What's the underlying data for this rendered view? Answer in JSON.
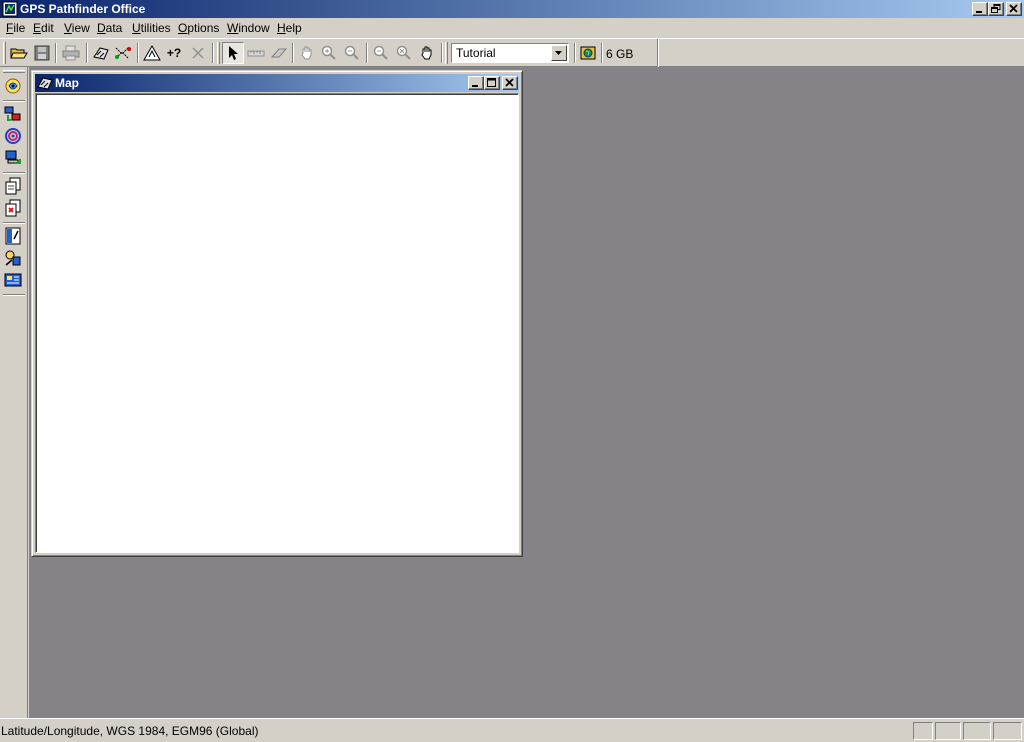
{
  "app": {
    "title": "GPS Pathfinder Office",
    "window_controls": [
      "minimize",
      "restore",
      "close"
    ]
  },
  "menu": {
    "items": [
      {
        "first": "F",
        "rest": "ile"
      },
      {
        "first": "E",
        "rest": "dit"
      },
      {
        "first": "V",
        "rest": "iew"
      },
      {
        "first": "D",
        "rest": "ata"
      },
      {
        "first": "U",
        "rest": "tilities"
      },
      {
        "first": "O",
        "rest": "ptions"
      },
      {
        "first": "W",
        "rest": "indow"
      },
      {
        "first": "H",
        "rest": "elp"
      }
    ]
  },
  "toolbar": {
    "project_combo_value": "Tutorial",
    "disk_space_label": "6 GB",
    "query_label": "+?"
  },
  "map_window": {
    "title": "Map"
  },
  "statusbar": {
    "coordinate_system": "Latitude/Longitude, WGS 1984, EGM96 (Global)"
  },
  "colors": {
    "titlebar_start": "#0a246a",
    "titlebar_end": "#a6caf0",
    "mdi_background": "#858387",
    "chrome": "#d4d0c8"
  }
}
